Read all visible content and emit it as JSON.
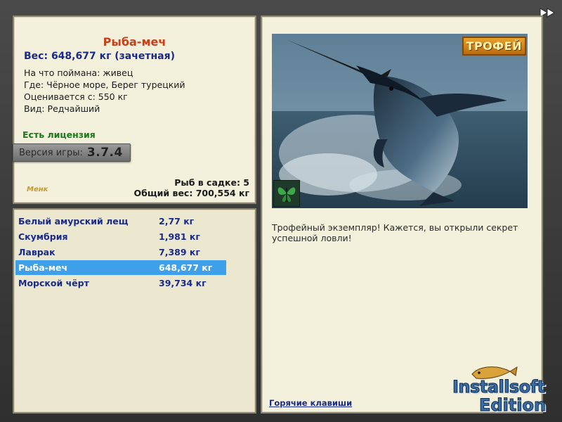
{
  "fish": {
    "title": "Рыба-меч",
    "weight": "Вес: 648,677 кг (зачетная)",
    "bait": "На что поймана: живец",
    "location": "Где: Чёрное море, Берег турецкий",
    "estimate": "Оценивается с: 550 кг",
    "rarity": "Вид: Редчайший"
  },
  "license": "Есть лицензия",
  "version": {
    "label": "Версия игры:",
    "number": "3.7.4"
  },
  "menu_logo": "Менк",
  "keepnet": {
    "count": "Рыб в садке: 5",
    "total_weight": "Общий вес: 700,554 кг"
  },
  "catch_list": [
    {
      "name": "Белый амурский лещ",
      "weight": "2,77 кг",
      "selected": false
    },
    {
      "name": "Скумбрия",
      "weight": "1,981 кг",
      "selected": false
    },
    {
      "name": "Лаврак",
      "weight": "7,389 кг",
      "selected": false
    },
    {
      "name": "Рыба-меч",
      "weight": "648,677 кг",
      "selected": true
    },
    {
      "name": "Морской чёрт",
      "weight": "39,734 кг",
      "selected": false
    }
  ],
  "trophy_badge": "ТРОФЕЙ",
  "trophy_message": "Трофейный экземпляр! Кажется, вы открыли секрет успешной ловли!",
  "hotkeys_link": "Горячие клавиши",
  "brand": {
    "line1": "Installsoft",
    "line2": "Edition"
  },
  "icons": {
    "fast_forward": "fast-forward-icon",
    "butterfly": "butterfly-icon"
  },
  "colors": {
    "panel_bg": "#f3f0dc",
    "title_red": "#c8401a",
    "fish_blue": "#1a2a8a",
    "license_green": "#1a7a1a",
    "selection_blue": "#3ea0ea"
  }
}
